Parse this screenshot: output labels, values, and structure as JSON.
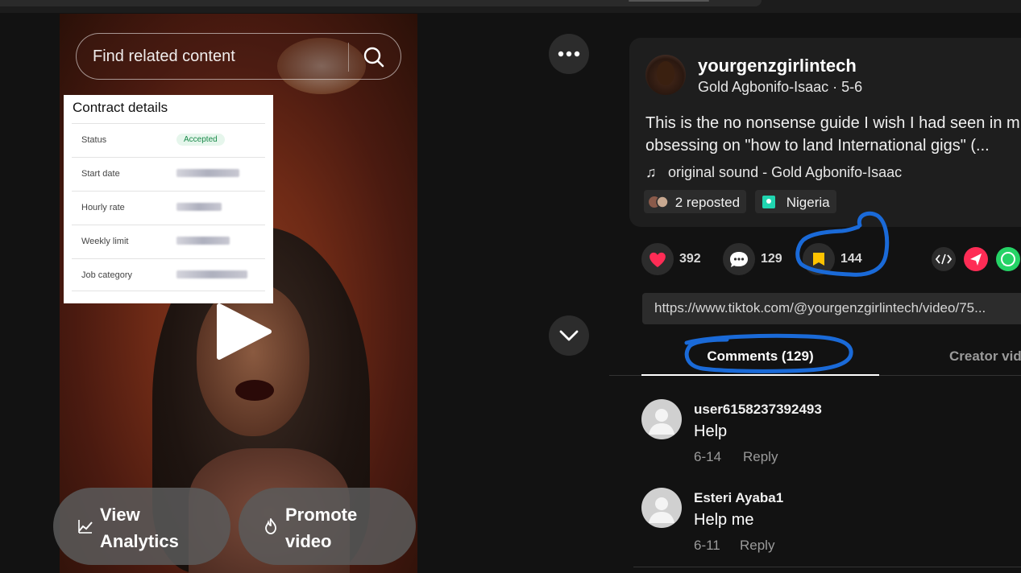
{
  "video": {
    "search_placeholder": "Find related content",
    "contract_card": {
      "title": "Contract details",
      "rows": [
        {
          "label": "Status",
          "value": "Accepted"
        },
        {
          "label": "Start date",
          "value": ""
        },
        {
          "label": "Hourly rate",
          "value": ""
        },
        {
          "label": "Weekly limit",
          "value": ""
        },
        {
          "label": "Job category",
          "value": ""
        }
      ]
    },
    "view_analytics_label": "View\nAnalytics",
    "promote_video_label": "Promote\nvideo"
  },
  "post": {
    "username": "yourgenzgirlintech",
    "author_line": "Gold Agbonifo-Isaac · 5-6",
    "description": "This is the no nonsense guide I wish I had seen in m\nobsessing on \"how to land International gigs\" (...",
    "sound": "original sound - Gold Agbonifo-Isaac",
    "reposted": "2 reposted",
    "location": "Nigeria"
  },
  "actions": {
    "likes": "392",
    "comments": "129",
    "saves": "144"
  },
  "share_url": "https://www.tiktok.com/@yourgenzgirlintech/video/75...",
  "tabs": {
    "comments": "Comments (129)",
    "creator_videos": "Creator vid"
  },
  "comments": [
    {
      "user": "user6158237392493",
      "text": "Help",
      "date": "6-14",
      "reply": "Reply"
    },
    {
      "user": "Esteri Ayaba1",
      "text": "Help me",
      "date": "6-11",
      "reply": "Reply"
    }
  ],
  "colors": {
    "like": "#fe2c55",
    "save": "#ffc300",
    "annotation": "#1a6ad8",
    "location_icon": "#20d5b0",
    "whatsapp": "#25d366"
  }
}
